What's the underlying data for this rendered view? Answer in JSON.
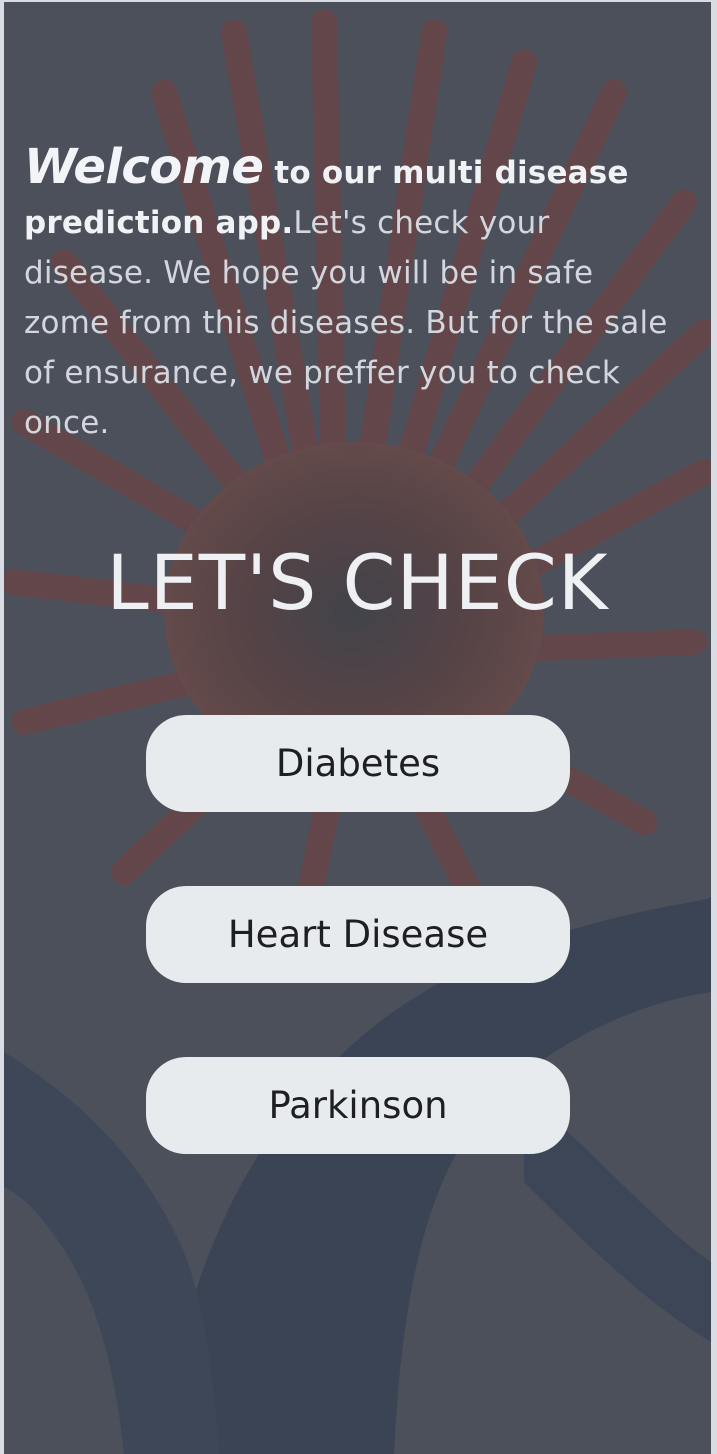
{
  "intro": {
    "welcome": "Welcome",
    "lead": " to our multi disease prediction app.",
    "body": "Let's check your disease. We hope you will be in safe zome from this diseases. But for the sale of ensurance, we preffer you to check once."
  },
  "headline": "LET'S CHECK",
  "buttons": {
    "diabetes": "Diabetes",
    "heart_disease": "Heart Disease",
    "parkinson": "Parkinson"
  },
  "colors": {
    "overlay": "#4a4f58",
    "button_bg": "#e8ebee",
    "button_text": "#1e1f22",
    "virus_red": "#8a3a32",
    "vein_blue": "#2f3d55"
  },
  "background_image": "virus-illustration"
}
